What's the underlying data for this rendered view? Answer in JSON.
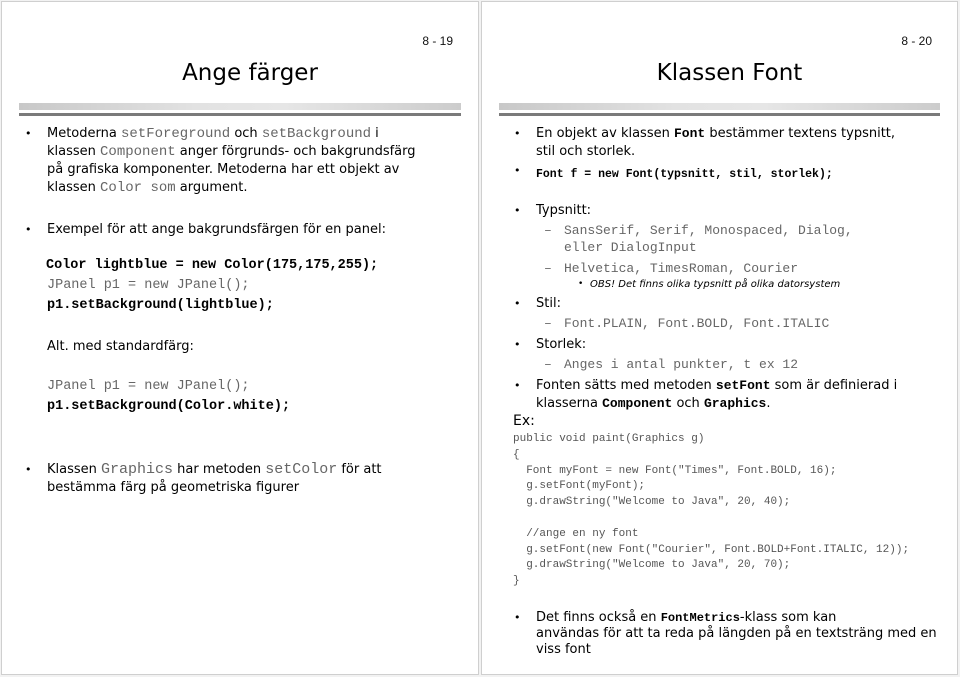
{
  "left_slide": {
    "page_number": "8  - 19",
    "title": "Ange färger",
    "bullet1": {
      "t1": "Metoderna ",
      "c1": "setForeground",
      "t2": " och ",
      "c2": "setBackground",
      "t3": " i",
      "t4": "klassen ",
      "c3": "Component",
      "t5": " anger förgrunds- och bakgrundsfärg",
      "line3": "på grafiska komponenter. Metoderna har ett objekt av",
      "t6": "klassen ",
      "c4": "Color som",
      "t7": " argument."
    },
    "bullet2": "Exempel för att ange bakgrundsfärgen för en panel:",
    "code1": [
      "Color lightblue = new Color(175,175,255);",
      "JPanel p1 = new JPanel();",
      "p1.setBackground(lightblue);"
    ],
    "alt_label": "Alt. med standardfärg:",
    "code2": [
      "JPanel p1 = new JPanel();",
      "p1.setBackground(Color.white);"
    ],
    "bullet3": {
      "t1": "Klassen ",
      "c1": "Graphics",
      "t2": " har metoden ",
      "c2": "setColor",
      "t3": " för att",
      "line2": "bestämma färg på geometriska figurer"
    }
  },
  "right_slide": {
    "page_number": "8  - 20",
    "title": "Klassen Font",
    "bullet1": {
      "t1": "En objekt av klassen ",
      "c1": "Font",
      "t2": " bestämmer textens typsnitt,",
      "line2": "stil och storlek."
    },
    "bullet2_code": "Font f = new Font(typsnitt, stil, storlek);",
    "typsnitt": {
      "label": "Typsnitt:",
      "items": [
        "SansSerif, Serif, Monospaced, Dialog,",
        "eller DialogInput",
        "Helvetica, TimesRoman, Courier"
      ],
      "note": "OBS! Det finns olika typsnitt på olika datorsystem"
    },
    "stil": {
      "label": "Stil:",
      "item": "Font.PLAIN, Font.BOLD, Font.ITALIC"
    },
    "storlek": {
      "label": "Storlek:",
      "item": "Anges i antal punkter, t ex 12"
    },
    "bullet_setfont": {
      "t1": "Fonten sätts med metoden ",
      "c1": "setFont",
      "t2": " som är definierad i",
      "t3": "klasserna ",
      "c2": "Component",
      "t4": " och ",
      "c3": "Graphics",
      "t5": "."
    },
    "ex_label": "Ex:",
    "example_code": [
      "public void paint(Graphics g)",
      "{",
      "  Font myFont = new Font(\"Times\", Font.BOLD, 16);",
      "  g.setFont(myFont);",
      "  g.drawString(\"Welcome to Java\", 20, 40);",
      "",
      "  //ange en ny font",
      "  g.setFont(new Font(\"Courier\", Font.BOLD+Font.ITALIC, 12));",
      "  g.drawString(\"Welcome to Java\", 20, 70);",
      "}"
    ],
    "bullet_metrics": {
      "t1": "Det finns också en ",
      "c1": "FontMetrics",
      "t2": "-klass som kan",
      "line2": "användas för att ta reda på längden på en textsträng med en",
      "line3": "viss font"
    }
  },
  "colors": {
    "code_gray": "#666666",
    "separator_dark": "#7a7a7a",
    "separator_light": "#e0e0e0"
  }
}
